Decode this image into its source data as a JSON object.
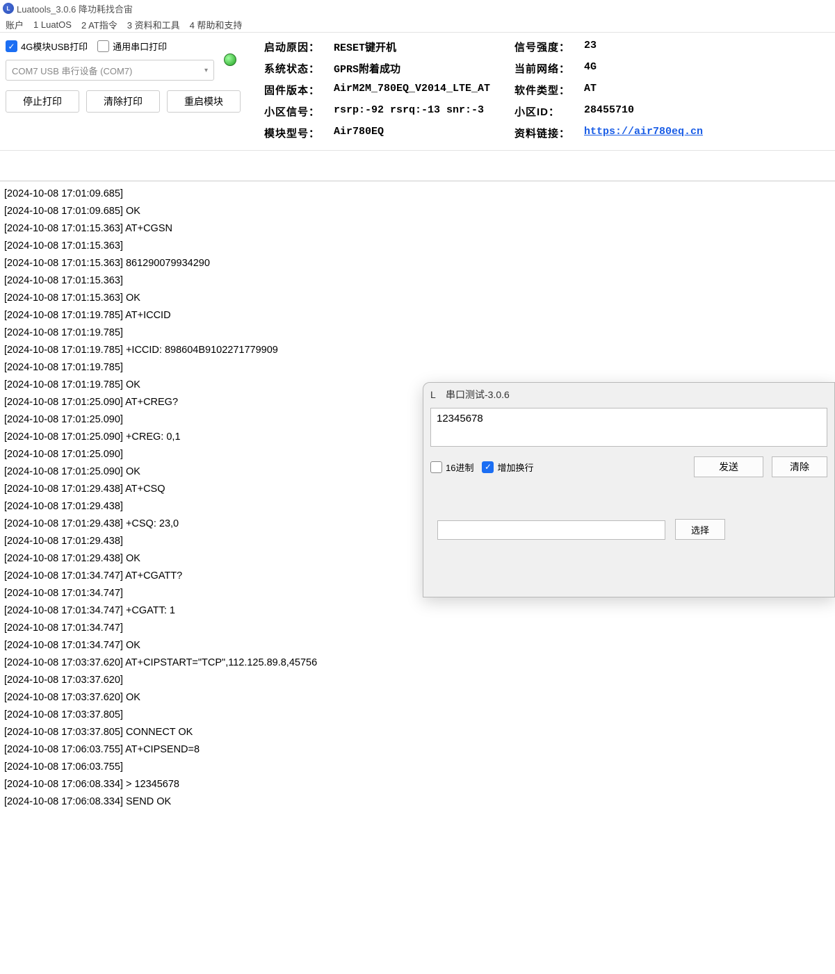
{
  "window": {
    "title": "Luatools_3.0.6 降功耗找合宙"
  },
  "menu": {
    "account": "账户",
    "luatos": "1 LuatOS",
    "at": "2 AT指令",
    "tools": "3 资料和工具",
    "help": "4 帮助和支持"
  },
  "controls": {
    "usb_print_label": "4G模块USB打印",
    "serial_print_label": "通用串口打印",
    "port_text": "COM7 USB 串行设备 (COM7)",
    "stop_print": "停止打印",
    "clear_print": "清除打印",
    "restart_module": "重启模块"
  },
  "status": {
    "boot_reason_label": "启动原因：",
    "boot_reason": "RESET键开机",
    "signal_label": "信号强度：",
    "signal": "23",
    "sys_state_label": "系统状态：",
    "sys_state": "GPRS附着成功",
    "network_label": "当前网络：",
    "network": "4G",
    "fw_label": "固件版本：",
    "fw": "AirM2M_780EQ_V2014_LTE_AT",
    "sw_type_label": "软件类型：",
    "sw_type": "AT",
    "cell_sig_label": "小区信号：",
    "cell_sig": "rsrp:-92 rsrq:-13 snr:-3",
    "cell_id_label": "小区ID：",
    "cell_id": "28455710",
    "model_label": "模块型号：",
    "model": "Air780EQ",
    "doc_label": "资料链接：",
    "doc_url": "https://air780eq.cn"
  },
  "log": [
    "[2024-10-08 17:01:09.685]",
    "[2024-10-08 17:01:09.685] OK",
    "[2024-10-08 17:01:15.363] AT+CGSN",
    "[2024-10-08 17:01:15.363]",
    "[2024-10-08 17:01:15.363] 861290079934290",
    "[2024-10-08 17:01:15.363]",
    "[2024-10-08 17:01:15.363] OK",
    "[2024-10-08 17:01:19.785] AT+ICCID",
    "[2024-10-08 17:01:19.785]",
    "[2024-10-08 17:01:19.785] +ICCID: 898604B9102271779909",
    "[2024-10-08 17:01:19.785]",
    "[2024-10-08 17:01:19.785] OK",
    "[2024-10-08 17:01:25.090] AT+CREG?",
    "[2024-10-08 17:01:25.090]",
    "[2024-10-08 17:01:25.090] +CREG: 0,1",
    "[2024-10-08 17:01:25.090]",
    "[2024-10-08 17:01:25.090] OK",
    "[2024-10-08 17:01:29.438] AT+CSQ",
    "[2024-10-08 17:01:29.438]",
    "[2024-10-08 17:01:29.438] +CSQ: 23,0",
    "[2024-10-08 17:01:29.438]",
    "[2024-10-08 17:01:29.438] OK",
    "[2024-10-08 17:01:34.747] AT+CGATT?",
    "[2024-10-08 17:01:34.747]",
    "[2024-10-08 17:01:34.747] +CGATT: 1",
    "[2024-10-08 17:01:34.747]",
    "[2024-10-08 17:01:34.747] OK",
    "[2024-10-08 17:03:37.620] AT+CIPSTART=\"TCP\",112.125.89.8,45756",
    "[2024-10-08 17:03:37.620]",
    "[2024-10-08 17:03:37.620] OK",
    "[2024-10-08 17:03:37.805]",
    "[2024-10-08 17:03:37.805] CONNECT OK",
    "[2024-10-08 17:06:03.755] AT+CIPSEND=8",
    "[2024-10-08 17:06:03.755]",
    "[2024-10-08 17:06:08.334] > 12345678",
    "[2024-10-08 17:06:08.334] SEND OK"
  ],
  "dialog": {
    "title": "串口测试-3.0.6",
    "input_value": "12345678",
    "hex_label": "16进制",
    "newline_label": "增加换行",
    "send": "发送",
    "clear": "清除",
    "select": "选择"
  }
}
